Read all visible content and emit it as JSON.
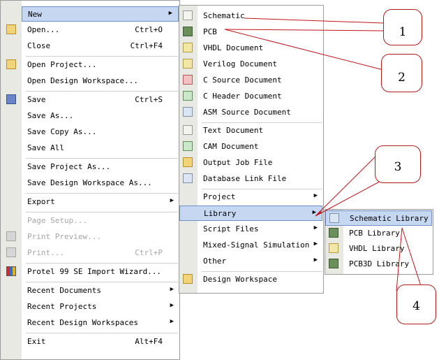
{
  "file_menu": [
    {
      "label": "New",
      "arrow": true,
      "highlight": true,
      "icon": "none"
    },
    {
      "label": "Open...",
      "shortcut": "Ctrl+O",
      "icon": "open-folder-icon"
    },
    {
      "label": "Close",
      "shortcut": "Ctrl+F4",
      "icon": "none"
    },
    {
      "sep": true
    },
    {
      "label": "Open Project...",
      "icon": "open-project-icon"
    },
    {
      "label": "Open Design Workspace...",
      "icon": "none"
    },
    {
      "sep": true
    },
    {
      "label": "Save",
      "shortcut": "Ctrl+S",
      "icon": "save-icon"
    },
    {
      "label": "Save As...",
      "icon": "none"
    },
    {
      "label": "Save Copy As...",
      "icon": "none"
    },
    {
      "label": "Save All",
      "icon": "none"
    },
    {
      "sep": true
    },
    {
      "label": "Save Project As...",
      "icon": "none"
    },
    {
      "label": "Save Design Workspace As...",
      "icon": "none"
    },
    {
      "sep": true
    },
    {
      "label": "Export",
      "arrow": true,
      "icon": "none"
    },
    {
      "sep": true
    },
    {
      "label": "Page Setup...",
      "disabled": true,
      "icon": "none"
    },
    {
      "label": "Print Preview...",
      "disabled": true,
      "icon": "print-preview-icon"
    },
    {
      "label": "Print...",
      "shortcut": "Ctrl+P",
      "disabled": true,
      "icon": "print-icon"
    },
    {
      "sep": true
    },
    {
      "label": "Protel 99 SE Import Wizard...",
      "icon": "import-wizard-icon"
    },
    {
      "sep": true
    },
    {
      "label": "Recent Documents",
      "arrow": true,
      "icon": "none"
    },
    {
      "label": "Recent Projects",
      "arrow": true,
      "icon": "none"
    },
    {
      "label": "Recent Design Workspaces",
      "arrow": true,
      "icon": "none"
    },
    {
      "sep": true
    },
    {
      "label": "Exit",
      "shortcut": "Alt+F4",
      "icon": "none"
    }
  ],
  "new_menu": [
    {
      "label": "Schematic",
      "icon": "schematic-doc-icon"
    },
    {
      "label": "PCB",
      "icon": "pcb-doc-icon"
    },
    {
      "label": "VHDL Document",
      "icon": "vhdl-doc-icon"
    },
    {
      "label": "Verilog Document",
      "icon": "verilog-doc-icon"
    },
    {
      "label": "C Source Document",
      "icon": "c-source-icon"
    },
    {
      "label": "C Header Document",
      "icon": "c-header-icon"
    },
    {
      "label": "ASM Source Document",
      "icon": "asm-source-icon"
    },
    {
      "sep": true
    },
    {
      "label": "Text Document",
      "icon": "text-doc-icon"
    },
    {
      "label": "CAM Document",
      "icon": "cam-doc-icon"
    },
    {
      "label": "Output Job File",
      "icon": "output-job-icon"
    },
    {
      "label": "Database Link File",
      "icon": "database-link-icon"
    },
    {
      "sep": true
    },
    {
      "label": "Project",
      "arrow": true,
      "icon": "none"
    },
    {
      "label": "Library",
      "arrow": true,
      "highlight": true,
      "icon": "none"
    },
    {
      "label": "Script Files",
      "arrow": true,
      "icon": "none"
    },
    {
      "label": "Mixed-Signal Simulation",
      "arrow": true,
      "icon": "none"
    },
    {
      "label": "Other",
      "arrow": true,
      "icon": "none"
    },
    {
      "sep": true
    },
    {
      "label": "Design Workspace",
      "icon": "design-workspace-icon"
    }
  ],
  "library_menu": [
    {
      "label": "Schematic Library",
      "highlight": true,
      "icon": "schematic-library-icon"
    },
    {
      "label": "PCB Library",
      "icon": "pcb-library-icon"
    },
    {
      "label": "VHDL Library",
      "icon": "vhdl-library-icon"
    },
    {
      "label": "PCB3D Library",
      "icon": "pcb3d-library-icon"
    }
  ],
  "callouts": [
    "1",
    "2",
    "3",
    "4"
  ],
  "colors": {
    "highlight": "#c6d7f2",
    "highlight_border": "#6f8fc9",
    "callout_line": "#c0141c",
    "gutter": "#e9e9e4"
  }
}
